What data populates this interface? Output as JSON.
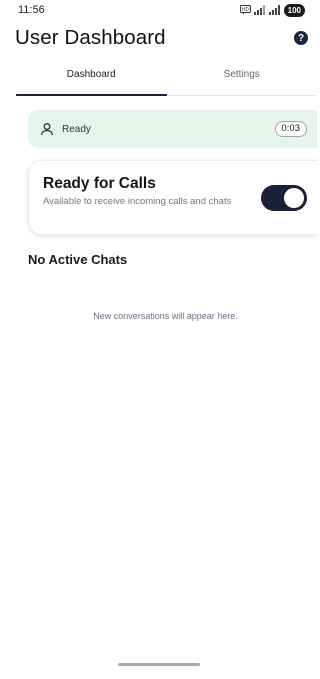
{
  "status_bar": {
    "time": "11:56",
    "battery": "100"
  },
  "header": {
    "title": "User Dashboard",
    "help_glyph": "?",
    "help_icon": "question-circle-icon"
  },
  "tabs": [
    {
      "label": "Dashboard",
      "active": true
    },
    {
      "label": "Settings",
      "active": false
    }
  ],
  "agent_status": {
    "icon": "person-icon",
    "label": "Ready",
    "timer": "0:03",
    "bg_color": "#e5f5ea"
  },
  "ready_card": {
    "title": "Ready for Calls",
    "description": "Available to receive incoming calls and chats",
    "toggle_on": true,
    "toggle_color": "#1b2237"
  },
  "chats": {
    "title": "No Active Chats",
    "empty_message": "New conversations will appear here."
  }
}
